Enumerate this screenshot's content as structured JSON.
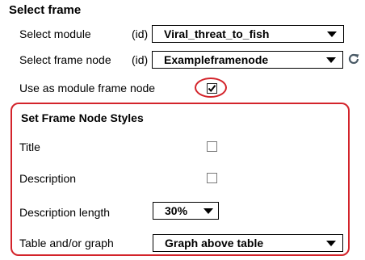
{
  "section": {
    "title": "Select frame"
  },
  "module_row": {
    "label": "Select module",
    "id_tag": "(id)",
    "value": "Viral_threat_to_fish"
  },
  "frame_node_row": {
    "label": "Select frame node",
    "id_tag": "(id)",
    "value": "Exampleframenode",
    "refresh_icon": "refresh-icon"
  },
  "use_as_module": {
    "label": "Use as module frame node",
    "checked": true
  },
  "styles": {
    "title": "Set Frame Node Styles",
    "title_row": {
      "label": "Title",
      "checked": false
    },
    "description_row": {
      "label": "Description",
      "checked": false
    },
    "description_length": {
      "label": "Description length",
      "value": "30%"
    },
    "table_graph": {
      "label": "Table and/or graph",
      "value": "Graph above table"
    }
  },
  "colors": {
    "highlight": "#d3232a",
    "refresh": "#4a5a66"
  }
}
